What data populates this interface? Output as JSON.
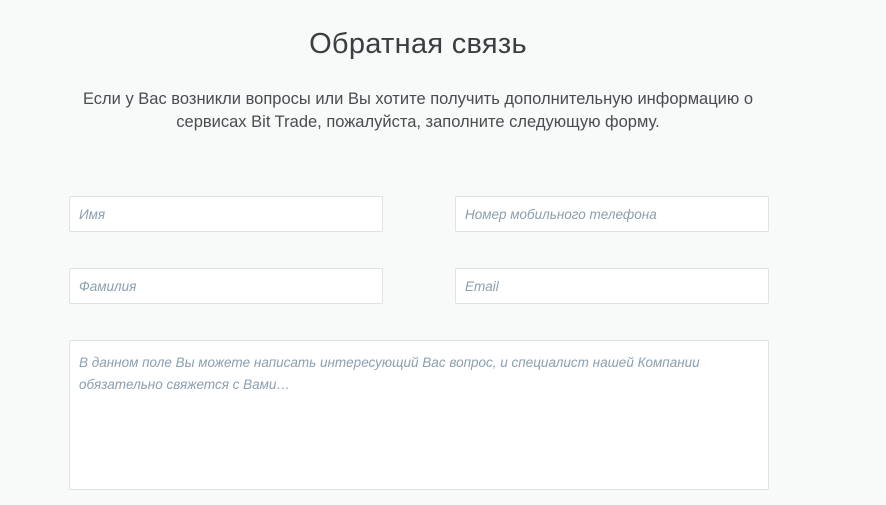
{
  "header": {
    "title": "Обратная связь",
    "subtitle": "Если у Вас возникли вопросы или Вы хотите получить дополнительную информацию о сервисах Bit Trade, пожалуйста, заполните следующую форму."
  },
  "form": {
    "name": {
      "placeholder": "Имя",
      "value": ""
    },
    "phone": {
      "placeholder": "Номер мобильного телефона",
      "value": ""
    },
    "surname": {
      "placeholder": "Фамилия",
      "value": ""
    },
    "email": {
      "placeholder": "Email",
      "value": ""
    },
    "message": {
      "placeholder": "В данном поле Вы можете написать интересующий Вас вопрос, и специалист нашей Компании обязательно свяжется с Вами…",
      "value": ""
    }
  },
  "colors": {
    "background": "#f8f9f9",
    "field_border": "#dfe3e5",
    "placeholder": "#8a9fb0",
    "text": "#3d3f42"
  }
}
